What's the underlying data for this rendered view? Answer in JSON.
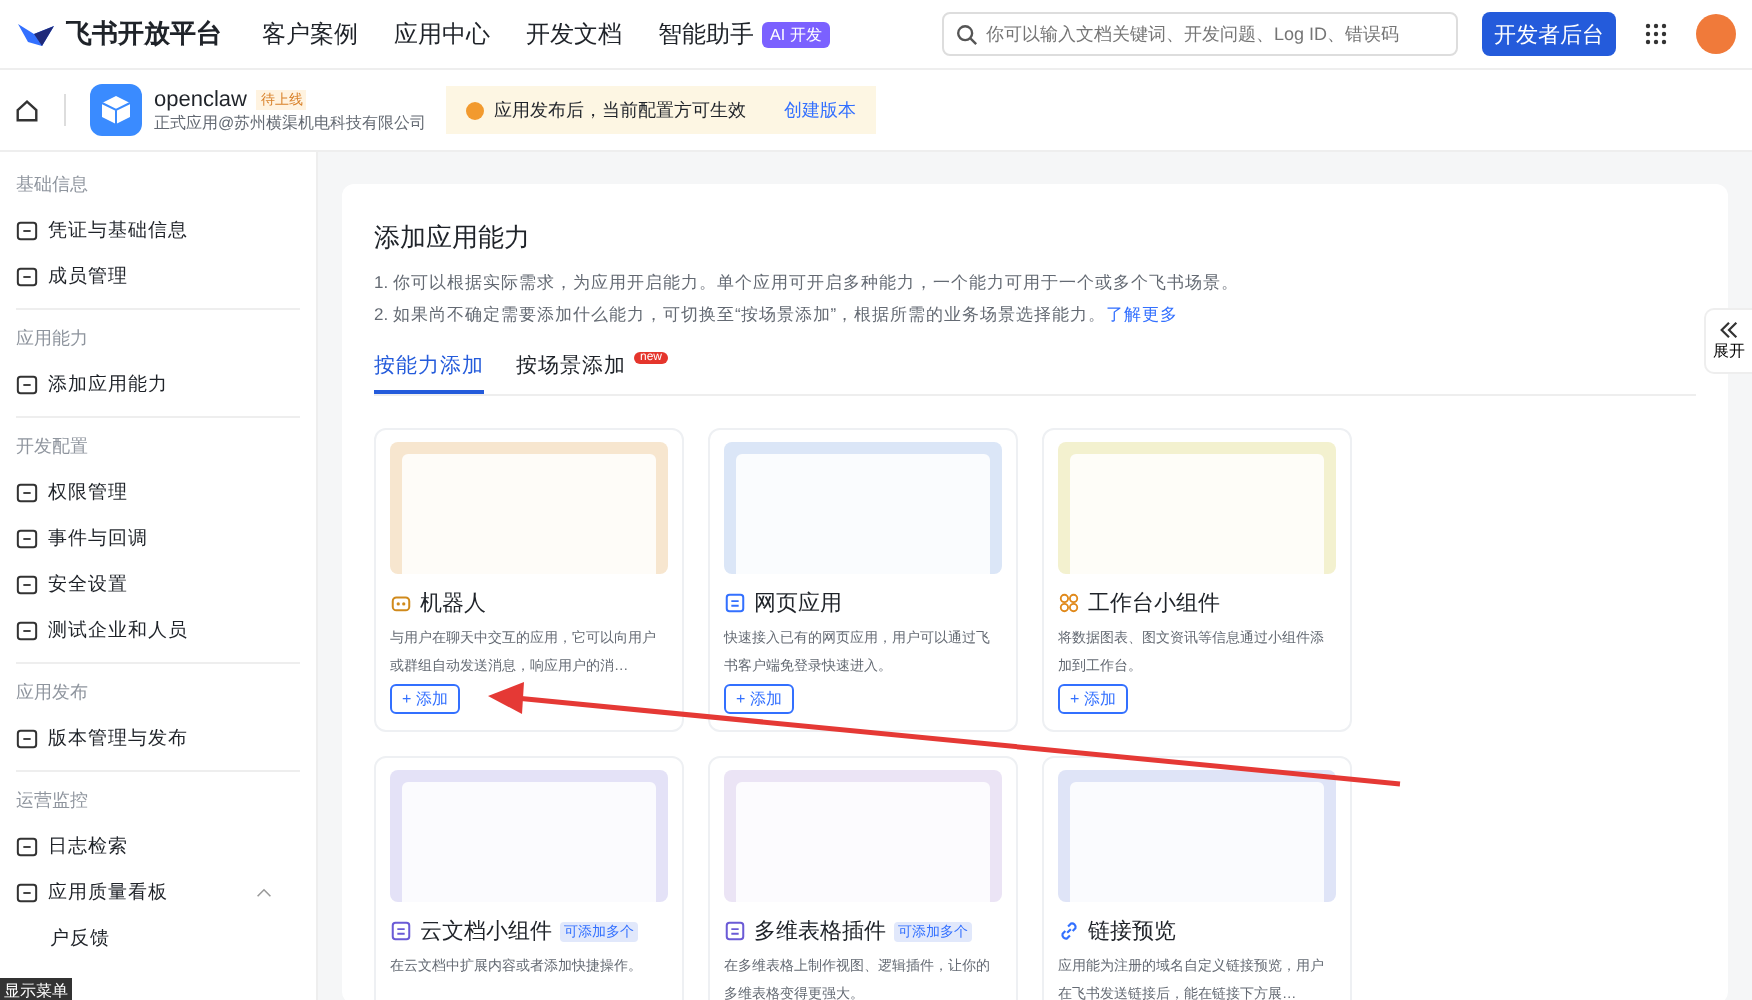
{
  "top_bar": {
    "logo": "飞书开放平台",
    "nav": [
      {
        "label": "客户案例"
      },
      {
        "label": "应用中心"
      },
      {
        "label": "开发文档"
      },
      {
        "label": "智能助手",
        "badge": "AI 开发"
      }
    ],
    "search": {
      "placeholder": "你可以输入文档关键词、开发问题、Log ID、错误码"
    },
    "console_button": "开发者后台"
  },
  "app_header": {
    "name": "openclaw",
    "status": "待上线",
    "subtitle": "正式应用@苏州横渠机电科技有限公司",
    "notice": "应用发布后，当前配置方可生效",
    "notice_link": "创建版本"
  },
  "sidebar": {
    "groups": [
      {
        "title": "基础信息",
        "items": [
          {
            "label": "凭证与基础信息"
          },
          {
            "label": "成员管理"
          }
        ]
      },
      {
        "title": "应用能力",
        "items": [
          {
            "label": "添加应用能力"
          }
        ]
      },
      {
        "title": "开发配置",
        "items": [
          {
            "label": "权限管理"
          },
          {
            "label": "事件与回调"
          },
          {
            "label": "安全设置"
          },
          {
            "label": "测试企业和人员"
          }
        ]
      },
      {
        "title": "应用发布",
        "items": [
          {
            "label": "版本管理与发布"
          }
        ]
      },
      {
        "title": "运营监控",
        "items": [
          {
            "label": "日志检索"
          },
          {
            "label": "应用质量看板",
            "expanded": true,
            "children": [
              {
                "label": "户反馈"
              }
            ]
          }
        ]
      }
    ],
    "tooltip": "显示菜单"
  },
  "panel": {
    "title": "添加应用能力",
    "lines": [
      "1. 你可以根据实际需求，为应用开启能力。单个应用可开启多种能力，一个能力可用于一个或多个飞书场景。",
      "2. 如果尚不确定需要添加什么能力，可切换至“按场景添加”，根据所需的业务场景选择能力。"
    ],
    "learn_more": "了解更多",
    "tabs": [
      {
        "label": "按能力添加",
        "selected": true
      },
      {
        "label": "按场景添加",
        "selected": false,
        "badge": "new"
      }
    ],
    "cards": [
      {
        "title": "机器人",
        "color": "#f7e6cf",
        "description": "与用户在聊天中交互的应用，它可以向用户或群组自动发送消息，响应用户的消…",
        "button": "+ 添加"
      },
      {
        "title": "网页应用",
        "color": "#dbe6f7",
        "description": "快速接入已有的网页应用，用户可以通过飞书客户端免登录快速进入。",
        "button": "+ 添加"
      },
      {
        "title": "工作台小组件",
        "color": "#f3f1cf",
        "description": "将数据图表、图文资讯等信息通过小组件添加到工作台。",
        "button": "+ 添加"
      },
      {
        "title": "云文档小组件",
        "color": "#e4e2f7",
        "badge": "可添加多个",
        "description": "在云文档中扩展内容或者添加快捷操作。"
      },
      {
        "title": "多维表格插件",
        "color": "#ebe4f5",
        "badge": "可添加多个",
        "description": "在多维表格上制作视图、逻辑插件，让你的多维表格变得更强大。"
      },
      {
        "title": "链接预览",
        "color": "#dfe4f7",
        "description": "应用能为注册的域名自定义链接预览，用户在飞书发送链接后，能在链接下方展…"
      }
    ]
  },
  "expand_button": "展开"
}
